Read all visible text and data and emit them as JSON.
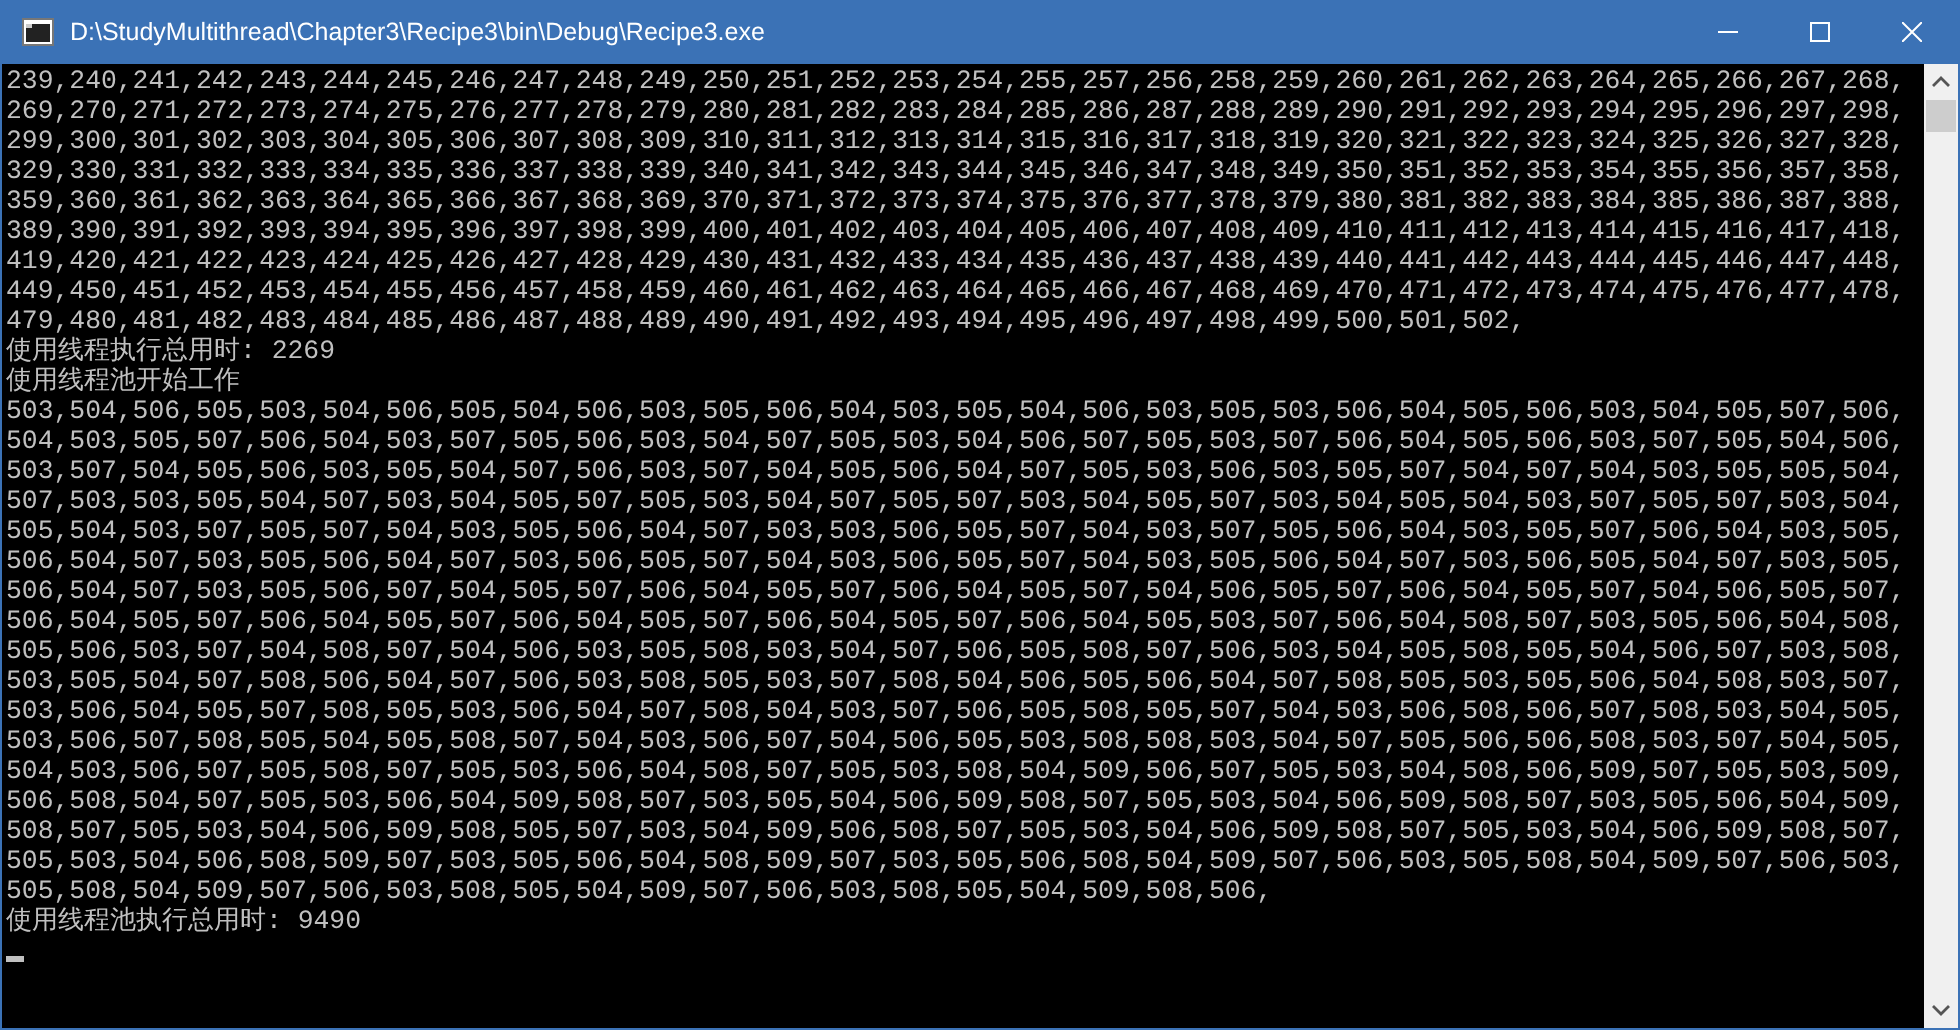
{
  "window": {
    "title": "D:\\StudyMultithread\\Chapter3\\Recipe3\\bin\\Debug\\Recipe3.exe"
  },
  "console": {
    "lines": [
      "239,240,241,242,243,244,245,246,247,248,249,250,251,252,253,254,255,257,256,258,259,260,261,262,263,264,265,266,267,268,",
      "269,270,271,272,273,274,275,276,277,278,279,280,281,282,283,284,285,286,287,288,289,290,291,292,293,294,295,296,297,298,",
      "299,300,301,302,303,304,305,306,307,308,309,310,311,312,313,314,315,316,317,318,319,320,321,322,323,324,325,326,327,328,",
      "329,330,331,332,333,334,335,336,337,338,339,340,341,342,343,344,345,346,347,348,349,350,351,352,353,354,355,356,357,358,",
      "359,360,361,362,363,364,365,366,367,368,369,370,371,372,373,374,375,376,377,378,379,380,381,382,383,384,385,386,387,388,",
      "389,390,391,392,393,394,395,396,397,398,399,400,401,402,403,404,405,406,407,408,409,410,411,412,413,414,415,416,417,418,",
      "419,420,421,422,423,424,425,426,427,428,429,430,431,432,433,434,435,436,437,438,439,440,441,442,443,444,445,446,447,448,",
      "449,450,451,452,453,454,455,456,457,458,459,460,461,462,463,464,465,466,467,468,469,470,471,472,473,474,475,476,477,478,",
      "479,480,481,482,483,484,485,486,487,488,489,490,491,492,493,494,495,496,497,498,499,500,501,502,",
      "使用线程执行总用时: 2269",
      "使用线程池开始工作",
      "503,504,506,505,503,504,506,505,504,506,503,505,506,504,503,505,504,506,503,505,503,506,504,505,506,503,504,505,507,506,",
      "504,503,505,507,506,504,503,507,505,506,503,504,507,505,503,504,506,507,505,503,507,506,504,505,506,503,507,505,504,506,",
      "503,507,504,505,506,503,505,504,507,506,503,507,504,505,506,504,507,505,503,506,503,505,507,504,507,504,503,505,505,504,",
      "507,503,503,505,504,507,503,504,505,507,505,503,504,507,505,507,503,504,505,507,503,504,505,504,503,507,505,507,503,504,",
      "505,504,503,507,505,507,504,503,505,506,504,507,503,503,506,505,507,504,503,507,505,506,504,503,505,507,506,504,503,505,",
      "506,504,507,503,505,506,504,507,503,506,505,507,504,503,506,505,507,504,503,505,506,504,507,503,506,505,504,507,503,505,",
      "506,504,507,503,505,506,507,504,505,507,506,504,505,507,506,504,505,507,504,506,505,507,506,504,505,507,504,506,505,507,",
      "506,504,505,507,506,504,505,507,506,504,505,507,506,504,505,507,506,504,505,503,507,506,504,508,507,503,505,506,504,508,",
      "505,506,503,507,504,508,507,504,506,503,505,508,503,504,507,506,505,508,507,506,503,504,505,508,505,504,506,507,503,508,",
      "503,505,504,507,508,506,504,507,506,503,508,505,503,507,508,504,506,505,506,504,507,508,505,503,505,506,504,508,503,507,",
      "503,506,504,505,507,508,505,503,506,504,507,508,504,503,507,506,505,508,505,507,504,503,506,508,506,507,508,503,504,505,",
      "503,506,507,508,505,504,505,508,507,504,503,506,507,504,506,505,503,508,508,503,504,507,505,506,506,508,503,507,504,505,",
      "504,503,506,507,505,508,507,505,503,506,504,508,507,505,503,508,504,509,506,507,505,503,504,508,506,509,507,505,503,509,",
      "506,508,504,507,505,503,506,504,509,508,507,503,505,504,506,509,508,507,505,503,504,506,509,508,507,503,505,506,504,509,",
      "508,507,505,503,504,506,509,508,505,507,503,504,509,506,508,507,505,503,504,506,509,508,507,505,503,504,506,509,508,507,",
      "505,503,504,506,508,509,507,503,505,506,504,508,509,507,503,505,506,508,504,509,507,506,503,505,508,504,509,507,506,503,",
      "505,508,504,509,507,506,503,508,505,504,509,507,506,503,508,505,504,509,508,506,",
      "使用线程池执行总用时: 9490"
    ]
  }
}
